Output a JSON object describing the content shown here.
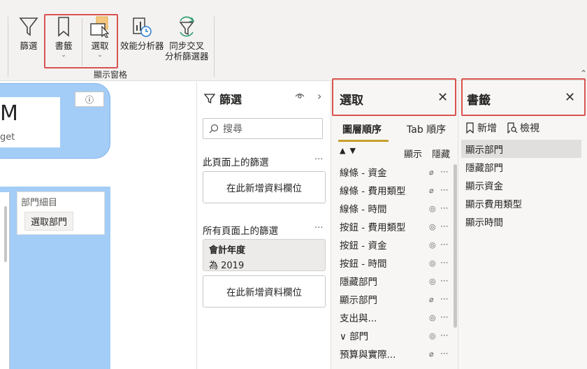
{
  "ribbon": {
    "filter_label": "篩選",
    "bookmark_label": "書籤",
    "selection_label": "選取",
    "perf_label": "效能分析器",
    "sync_label": "同步交叉\n分析篩選器",
    "sync_line1": "同步交叉",
    "sync_line2": "分析篩選器",
    "group_label": "顯示窗格",
    "chevron": "⌄",
    "highlight_color": "#d9534f"
  },
  "canvas": {
    "title_fragment": "M",
    "subtitle_fragment": "get",
    "info_icon": "ⓘ",
    "slicer_title": "部門細目",
    "slicer_chip": "選取部門",
    "card_color": "#a3cdf6"
  },
  "filter_pane": {
    "title": "篩選",
    "search_placeholder": "搜尋",
    "this_page_label": "此頁面上的篩選",
    "add_field_1": "在此新增資料欄位",
    "all_pages_label": "所有頁面上的篩選",
    "filter_card_name": "會計年度",
    "filter_card_value": "為 2019",
    "add_field_2": "在此新增資料欄位",
    "dots": "···"
  },
  "selection_pane": {
    "title": "選取",
    "tab_layer_order": "圖層順序",
    "tab_tab_order": "Tab 順序",
    "show_label": "顯示",
    "hide_label": "隱藏",
    "items": [
      {
        "label": "線條 - 資金"
      },
      {
        "label": "線條 - 費用類型"
      },
      {
        "label": "線條 - 時間"
      },
      {
        "label": "按鈕 - 費用類型"
      },
      {
        "label": "按鈕 - 資金"
      },
      {
        "label": "按鈕 - 時間"
      },
      {
        "label": "隱藏部門"
      },
      {
        "label": "顯示部門"
      },
      {
        "label": "支出與..."
      },
      {
        "label": "∨  部門"
      },
      {
        "label": "預算與實際..."
      }
    ]
  },
  "bookmark_pane": {
    "title": "書籤",
    "add_label": "新增",
    "view_label": "檢視",
    "items": [
      {
        "label": "顯示部門"
      },
      {
        "label": "隱藏部門"
      },
      {
        "label": "顯示資金"
      },
      {
        "label": "顯示費用類型"
      },
      {
        "label": "顯示時間"
      }
    ]
  }
}
